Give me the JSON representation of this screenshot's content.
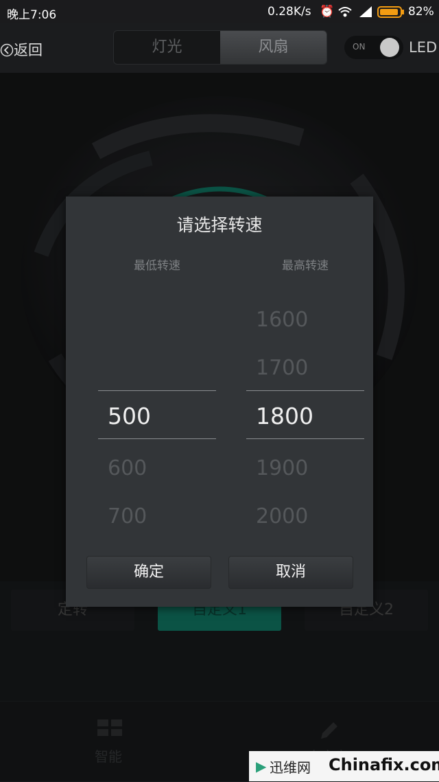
{
  "status": {
    "time": "晚上7:06",
    "speed": "0.28K/s",
    "battery": "82%"
  },
  "header": {
    "back_label": "返回",
    "tab_light": "灯光",
    "tab_fan": "风扇",
    "toggle_on": "ON",
    "led_label": "LED"
  },
  "modes": {
    "fixed": "定转",
    "custom1": "自定义1",
    "custom2": "自定义2"
  },
  "nav": {
    "smart": "智能",
    "custom": "自定义"
  },
  "dialog": {
    "title": "请选择转速",
    "min_header": "最低转速",
    "max_header": "最高转速",
    "min_values": {
      "selected": "500",
      "below1": "600",
      "below2": "700"
    },
    "max_values": {
      "above2": "1600",
      "above1": "1700",
      "selected": "1800",
      "below1": "1900",
      "below2": "2000"
    },
    "confirm": "确定",
    "cancel": "取消"
  },
  "watermark": {
    "cn": "迅维网",
    "en": "Chinafix.com"
  },
  "colors": {
    "accent": "#12806b",
    "dialog_bg": "#323538"
  }
}
